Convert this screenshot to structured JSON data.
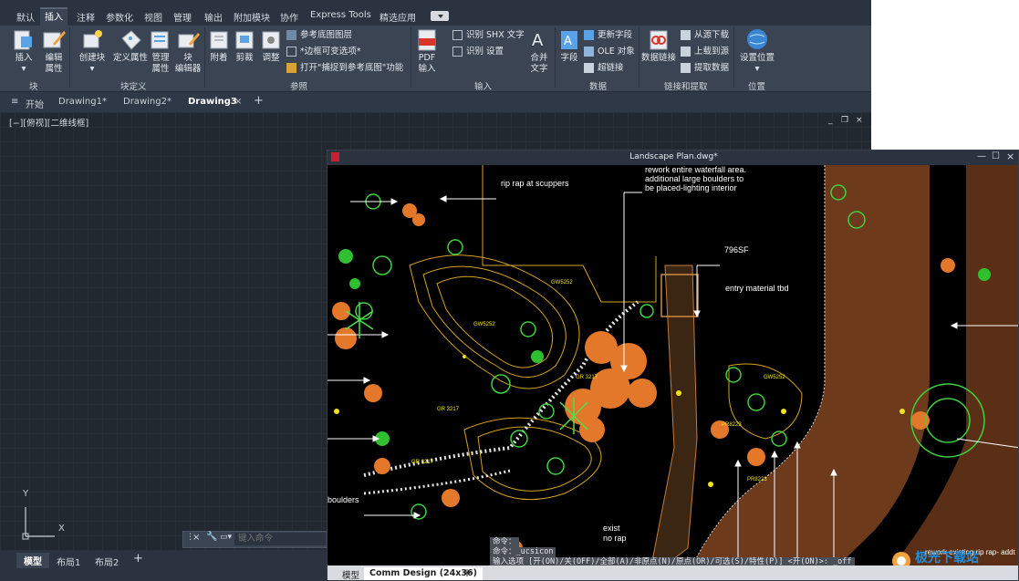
{
  "menu": {
    "tabs": [
      "默认",
      "插入",
      "注释",
      "参数化",
      "视图",
      "管理",
      "输出",
      "附加模块",
      "协作",
      "Express Tools",
      "精选应用"
    ],
    "active": "插入"
  },
  "ribbon": {
    "buttons": {
      "insert": "插入",
      "edit_attr_1": "编辑",
      "edit_attr_2": "属性",
      "create_block": "创建块",
      "define_attr": "定义属性",
      "manage_attr_1": "管理",
      "manage_attr_2": "属性",
      "block_editor_1": "块",
      "block_editor_2": "编辑器",
      "attach": "附着",
      "clip": "剪裁",
      "adjust": "调整",
      "ref_layers": "参考底图图层",
      "frame_vary": "*边框可变选项*",
      "snap_toggle": "打开\"捕捉到参考底图\"功能",
      "pdf_import_1": "PDF",
      "pdf_import_2": "输入",
      "recognize_shx": "识别 SHX 文字",
      "recognize_settings": "识别 设置",
      "combine_text_1": "合并",
      "combine_text_2": "文字",
      "field": "字段",
      "update_fields": "更新字段",
      "ole_object": "OLE 对象",
      "hyperlink": "超链接",
      "data_link": "数据链接",
      "download_source": "从源下载",
      "upload_source": "上载到源",
      "extract_data": "提取数据",
      "set_location_1": "设置位置"
    },
    "groups": {
      "block": "块",
      "block_def": "块定义",
      "reference": "参照",
      "import": "输入",
      "data": "数据",
      "linking": "链接和提取",
      "location": "位置"
    }
  },
  "doc_tabs": {
    "start": "开始",
    "items": [
      "Drawing1*",
      "Drawing2*",
      "Drawing3"
    ],
    "active": "Drawing3",
    "close": "×",
    "plus": "+"
  },
  "viewport": {
    "label": "[−][俯视][二维线框]",
    "minimize": "_",
    "restore": "❐",
    "close": "×"
  },
  "ucs": {
    "y": "Y",
    "x": "X"
  },
  "command": {
    "placeholder": "键入命令"
  },
  "layout_tabs": {
    "items": [
      "模型",
      "布局1",
      "布局2"
    ],
    "active": "模型",
    "plus": "+"
  },
  "second_window": {
    "title": "Landscape Plan.dwg*",
    "cad_labels": {
      "rip_rap": "rip rap at scuppers",
      "waterfall_1": "rework entire waterfall area.",
      "waterfall_2": "additional large boulders to",
      "waterfall_3": "be placed-lighting interior",
      "sf796": "796SF",
      "entry": "entry material tbd",
      "boulders": "boulders",
      "exist": "exist",
      "norap": "no rap",
      "rework_exist": "rework existing rip rap- addt",
      "gw1": "GW5252",
      "gw2": "GW5252",
      "gr1": "GR 3217",
      "gr2": "GR 3217",
      "gr3": "GR 3217",
      "pr1": "PR8223",
      "pr2": "PR8223",
      "gw3": "GW5252"
    },
    "cmd": {
      "line1": "命令：",
      "line2": "命令：_ucsicon",
      "line3": "输入选项 [开(ON)/关(OFF)/全部(A)/非原点(N)/原点(OR)/可选(S)/特性(P)] <开(ON)>: _off"
    },
    "tabs": {
      "model": "模型",
      "layout": "Comm Design (24x36)",
      "plus": "+"
    },
    "watermark": "极光下载站"
  }
}
